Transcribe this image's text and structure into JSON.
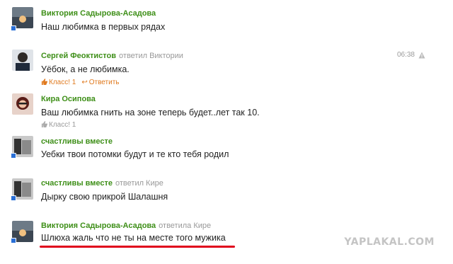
{
  "colors": {
    "author": "#3e8f18",
    "like": "#e07a1f",
    "online": "#2a6fd6",
    "underline": "#e0001b"
  },
  "comments": [
    {
      "author": "Виктория Садырова-Асадова",
      "reply": "",
      "text": "Наш любимка в первых рядах"
    },
    {
      "author": "Сергей Феоктистов",
      "reply": "ответил Виктории",
      "text": "Уёбок, а не любимка.",
      "like": "Класс! 1",
      "reply_btn": "Ответить",
      "time": "06:38"
    },
    {
      "author": "Кира Осипова",
      "reply": "",
      "text": "Ваш любимка гнить на зоне теперь будет..лет так 10.",
      "like": "Класс! 1"
    },
    {
      "author": "счастливы вместе",
      "reply": "",
      "text": "Уебки твои потомки будут и те кто тебя родил"
    },
    {
      "author": "счастливы вместе",
      "reply": "ответил Кире",
      "text": "Дырку свою прикрой Шалашня"
    },
    {
      "author": "Виктория Садырова-Асадова",
      "reply": "ответила Кире",
      "text": "Шлюха жаль что не ты на месте того мужика"
    }
  ],
  "watermark": "YAPLAKAL.COM"
}
